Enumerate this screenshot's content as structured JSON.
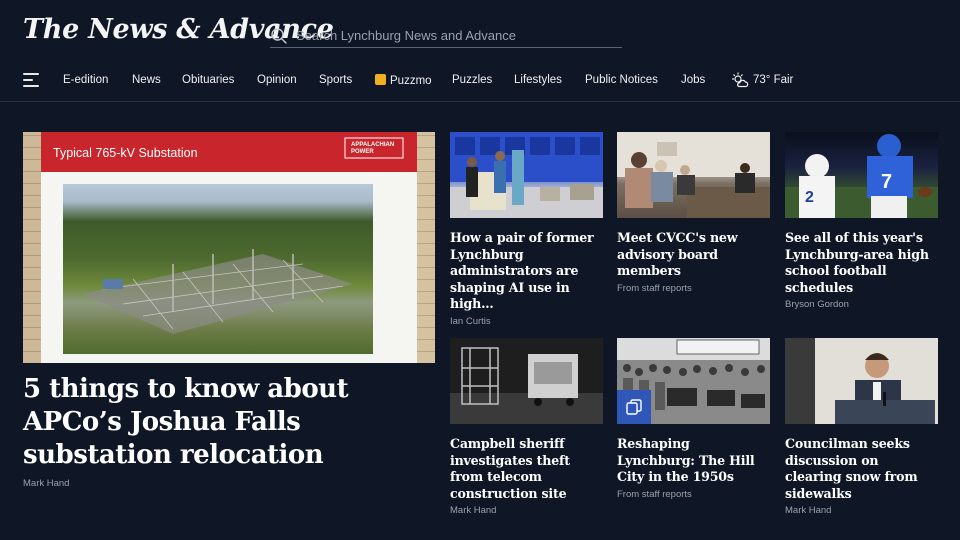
{
  "masthead": {
    "logo_text": "The News & Advance",
    "search_placeholder": "Search Lynchburg News and Advance"
  },
  "nav": {
    "items": [
      {
        "label": "E-edition"
      },
      {
        "label": "News"
      },
      {
        "label": "Obituaries"
      },
      {
        "label": "Opinion"
      },
      {
        "label": "Sports"
      },
      {
        "label": "Puzzmo"
      },
      {
        "label": "Puzzles"
      },
      {
        "label": "Lifestyles"
      },
      {
        "label": "Public Notices"
      },
      {
        "label": "Jobs"
      }
    ],
    "weather": "73° Fair"
  },
  "lead": {
    "image_sign_text": "Typical 765-kV Substation",
    "image_logo_text": "APPALACHIAN POWER",
    "headline": "5 things to know about APCo’s Joshua Falls substation relocation",
    "byline": "Mark Hand"
  },
  "cards": [
    {
      "headline": "How a pair of former Lynchburg administrators are shaping AI use in high…",
      "byline": "Ian Curtis"
    },
    {
      "headline": "Meet CVCC's new advisory board members",
      "byline": "From staff reports"
    },
    {
      "headline": "See all of this year's Lynchburg-area high school football schedules",
      "byline": "Bryson Gordon"
    },
    {
      "headline": "Campbell sheriff investigates theft from telecom construction site",
      "byline": "Mark Hand"
    },
    {
      "headline": "Reshaping Lynchburg: The Hill City in the 1950s",
      "byline": "From staff reports"
    },
    {
      "headline": "Councilman seeks discussion on clearing snow from sidewalks",
      "byline": "Mark Hand"
    }
  ],
  "colors": {
    "background": "#0f1726",
    "accent_red": "#c8252d",
    "puzzmo_yellow": "#f2b01e",
    "gallery_blue": "#2f57b8"
  }
}
